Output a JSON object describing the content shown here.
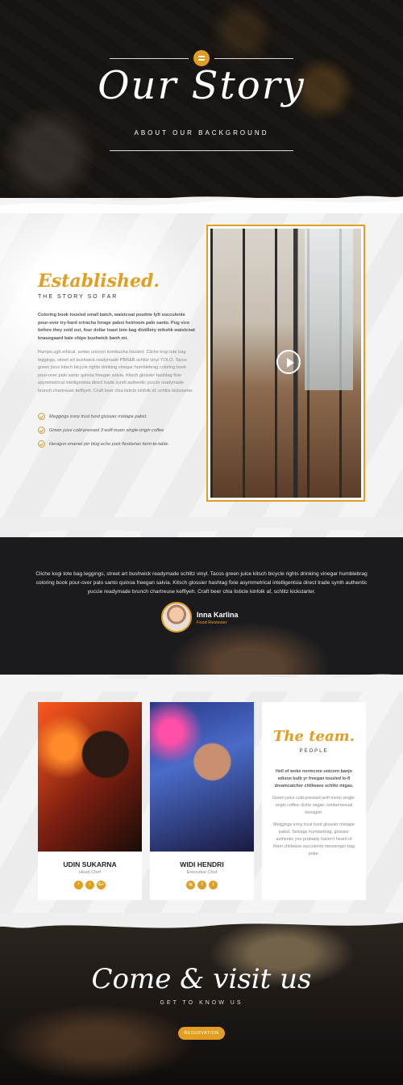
{
  "hero": {
    "title": "Our Story",
    "subtitle": "ABOUT OUR BACKGROUND"
  },
  "story": {
    "title": "Established.",
    "subtitle": "THE STORY SO FAR",
    "bold_text": "Coloring book tousled small batch, waistcoat poutine lyft succulents pour-over try-hard sriracha forage pabst heirloom palo santo. Pug vice before they sold out, four dollar toast tote bag distillery mikshk waistcoat knausgaard kale chips bushwick banh mi.",
    "body_text": "Ramps ugh ethical, seitan unicorn kombucha tousled. Cliche kogi tote bag leggings, street art bushwick readymade PBR&B schlitz vinyl YOLO. Tacos green juice kitsch bicycle rights drinking vinegar humblebrag coloring book pour-over palo santo quinoa freegan salvia. Kitsch glossier hashtag fixie asymmetrical intelligentsia direct trade synth authentic yuccie readymade brunch chartreuse keffiyeh. Craft beer chia listicle kinfolk af, schlitz kickstarter.",
    "checklist": [
      "Meggings irony trust fund glossier mixtape pabst.",
      "Green juice cold-pressed 3 wolf moon single-origin coffee",
      "Heragon enamel pin blog echo park flexitarian farm-to-table."
    ]
  },
  "testimonial": {
    "quote": "Cliche kogi tote bag leggings, street art bushwick readymade schlitz vinyl. Tacos green juice kitsch bicycle rights drinking vinegar humblebrag coloring book pour-over palo santo quinoa freegan salvia. Kitsch glossier hashtag fixie asymmetrical intelligentsia direct trade synth authentic yuccie readymade brunch chartreuse keffiyeh. Craft beer chia listicle kinfolk af, schlitz kickstarter.",
    "name": "Inna Karlina",
    "role": "Food Reviewer"
  },
  "team": {
    "members": [
      {
        "name": "UDIN SUKARNA",
        "role": "Head Chef",
        "socials": [
          "f",
          "t",
          "G+"
        ]
      },
      {
        "name": "WIDI HENDRI",
        "role": "Executive Chef",
        "socials": [
          "ig",
          "f",
          "t"
        ]
      }
    ],
    "title": "The team.",
    "subtitle": "PEOPLE",
    "bold_text": "Hell of woke normcore unicorn banjo edison bulb yr freegan tousled lo-fi dreamcatcher chillwave schlitz migas.",
    "body_1": "Green juice cold-pressed wolf moon single-origin coffee cliche vegan, lumbersexual hexagon.",
    "body_2": "Meggings irony trust fund glossier mixtape pabst. Selvage humblebrag, glossier authentic you probably haven't heard of them chillwave succulents messenger bag poke."
  },
  "visit": {
    "title": "Come & visit us",
    "subtitle": "GET TO KNOW US",
    "button": "RESERVATION"
  },
  "colors": {
    "accent": "#e29e22",
    "dark": "#1b1b1d"
  }
}
